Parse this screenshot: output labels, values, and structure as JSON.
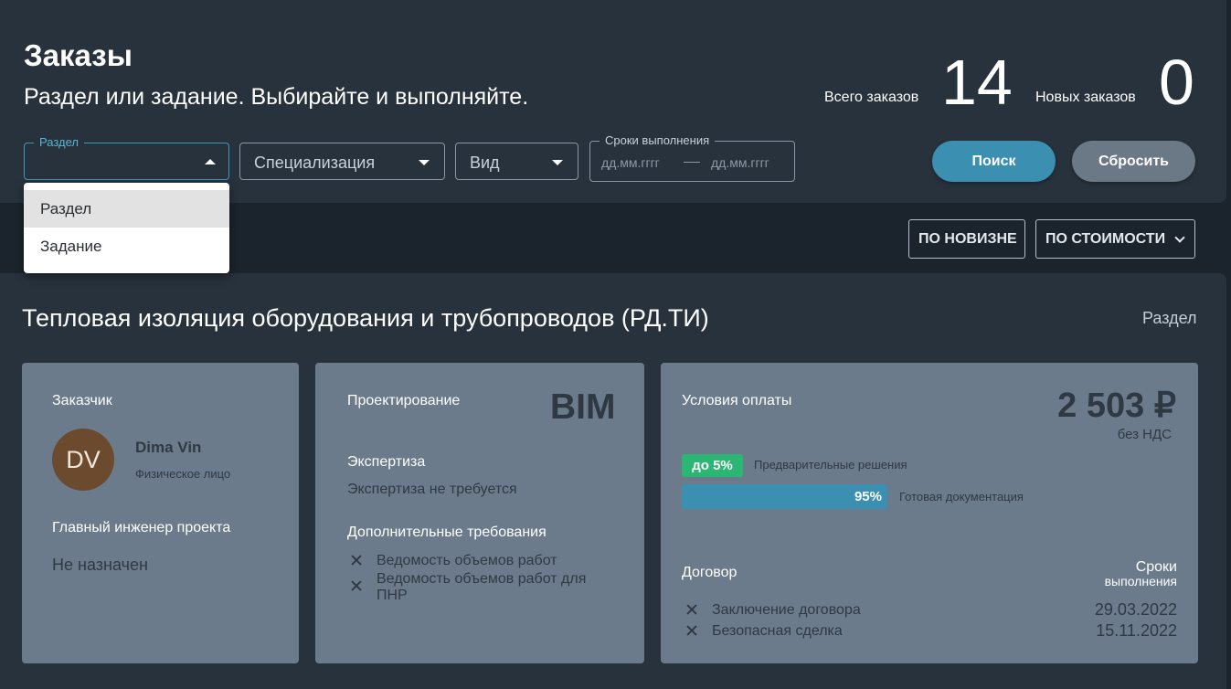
{
  "header": {
    "title": "Заказы",
    "subtitle": "Раздел или задание. Выбирайте и выполняйте.",
    "stats": {
      "total_label": "Всего заказов",
      "total_value": "14",
      "new_label": "Новых заказов",
      "new_value": "0"
    }
  },
  "filters": {
    "section": {
      "label": "Раздел",
      "value": ""
    },
    "specialization": {
      "value": "Специализация"
    },
    "kind": {
      "value": "Вид"
    },
    "deadline": {
      "label": "Сроки выполнения",
      "from_placeholder": "дд.мм.гггг",
      "to_placeholder": "дд.мм.гггг"
    },
    "search_label": "Поиск",
    "reset_label": "Сбросить"
  },
  "dropdown": {
    "options": [
      "Раздел",
      "Задание"
    ],
    "selected": "Раздел"
  },
  "sort": {
    "newest_label": "ПО НОВИЗНЕ",
    "price_label": "ПО СТОИМОСТИ"
  },
  "order": {
    "title": "Тепловая изоляция оборудования и трубопроводов (РД.ТИ)",
    "type": "Раздел",
    "customer": {
      "label": "Заказчик",
      "initials": "DV",
      "name": "Dima Vin",
      "kind": "Физическое лицо",
      "avatar_color": "#6b4a2e"
    },
    "chief_engineer": {
      "label": "Главный инженер проекта",
      "value": "Не назначен"
    },
    "design": {
      "label": "Проектирование",
      "value": "BIM"
    },
    "expertise": {
      "label": "Экспертиза",
      "value": "Экспертиза не требуется"
    },
    "additional": {
      "label": "Дополнительные требования",
      "items": [
        "Ведомость объемов работ",
        "Ведомость объемов работ для",
        "ПНР"
      ]
    },
    "payment": {
      "label": "Условия оплаты",
      "price": "2 503 ₽",
      "vat": "без НДС",
      "prepay_badge": "до 5%",
      "prepay_label": "Предварительные решения",
      "final_percent": "95%",
      "final_label": "Готовая документация",
      "accent_green": "#2bb673",
      "accent_blue": "#3b8fb0"
    },
    "contract": {
      "label": "Договор",
      "deadline_label_1": "Сроки",
      "deadline_label_2": "выполнения",
      "items": [
        {
          "name": "Заключение договора",
          "date": "29.03.2022"
        },
        {
          "name": "Безопасная сделка",
          "date": "15.11.2022"
        }
      ]
    }
  }
}
